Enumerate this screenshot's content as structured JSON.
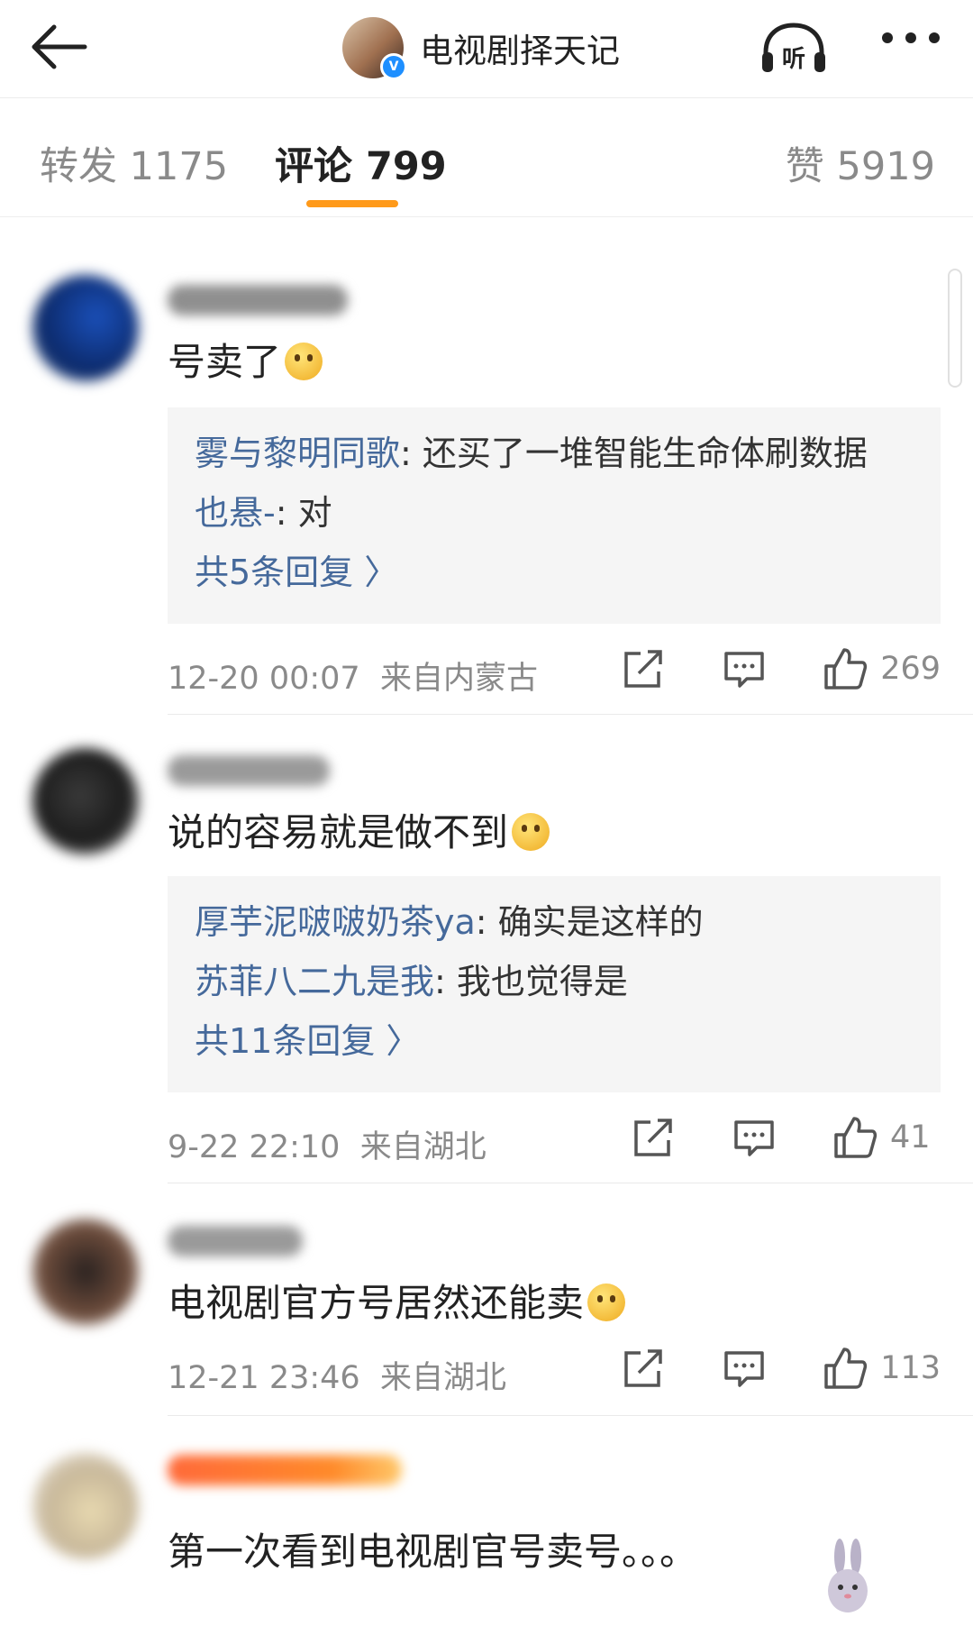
{
  "header": {
    "account_name": "电视剧择天记",
    "verified_mark": "V",
    "icons": [
      "back-arrow-icon",
      "headphones-listen-icon",
      "more-dots-icon"
    ],
    "listen_label": "听"
  },
  "tabs": [
    {
      "label": "转发 1175",
      "active": false
    },
    {
      "label": "评论 799",
      "active": true
    },
    {
      "label": "赞 5919",
      "active": false
    }
  ],
  "accent_color": "#ff9a1a",
  "link_color": "#45699b",
  "comments": [
    {
      "text": "号卖了",
      "replies": [
        {
          "user": "雾与黎明同歌",
          "text": ": 还买了一堆智能生命体刷数据"
        },
        {
          "user": "也悬-",
          "text": ": 对"
        }
      ],
      "more_replies": "共5条回复 〉",
      "time": "12-20 00:07",
      "location": "来自内蒙古",
      "likes": "269"
    },
    {
      "text": "说的容易就是做不到",
      "replies": [
        {
          "user": "厚芋泥啵啵奶茶ya",
          "text": ": 确实是这样的"
        },
        {
          "user": "苏菲八二九是我",
          "text": ": 我也觉得是"
        }
      ],
      "more_replies": "共11条回复 〉",
      "time": "9-22 22:10",
      "location": "来自湖北",
      "likes": "41"
    },
    {
      "text": "电视剧官方号居然还能卖",
      "time": "12-21 23:46",
      "location": "来自湖北",
      "likes": "113"
    },
    {
      "text": "第一次看到电视剧官号卖号。。。"
    }
  ]
}
